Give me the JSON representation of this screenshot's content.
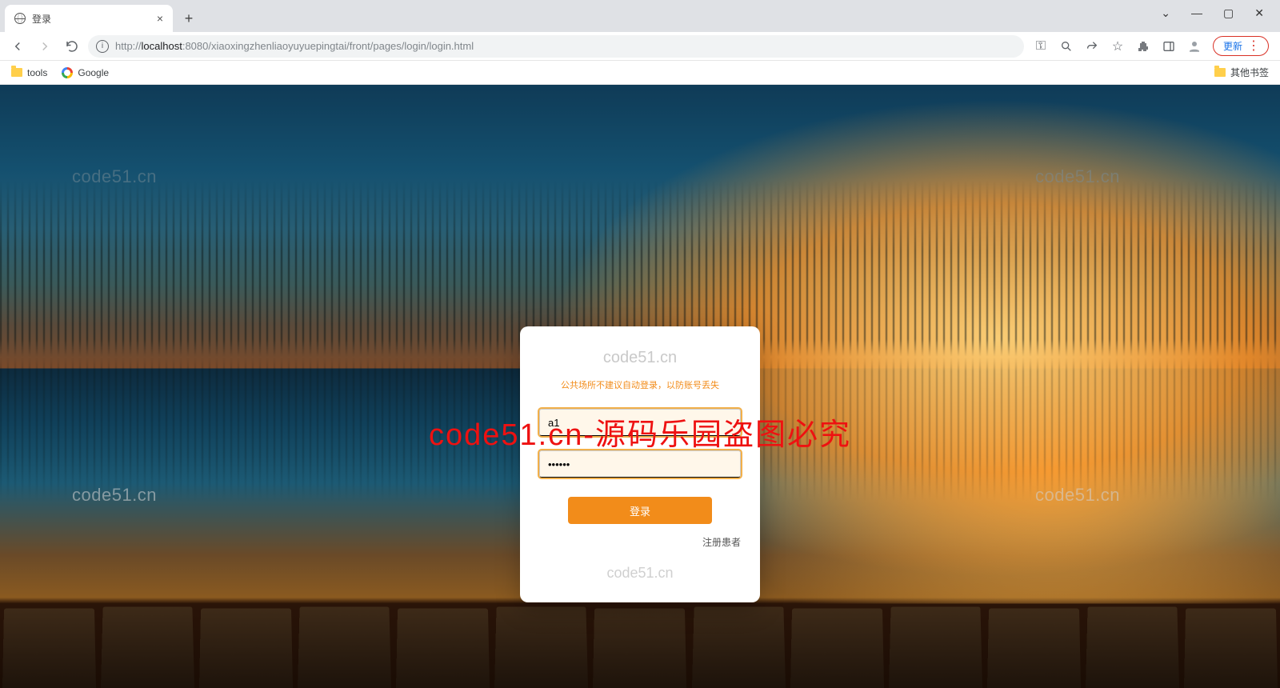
{
  "browser": {
    "tab_title": "登录",
    "new_tab": "+",
    "close_tab": "×",
    "url_prefix": "http://",
    "url_host": "localhost",
    "url_port": ":8080",
    "url_path": "/xiaoxingzhenliaoyuyuepingtai/front/pages/login/login.html",
    "update_label": "更新",
    "bookmarks": {
      "tools": "tools",
      "google": "Google",
      "other": "其他书签"
    }
  },
  "watermarks": {
    "text": "code51.cn",
    "big": "code51.cn-源码乐园盗图必究"
  },
  "login": {
    "hint": "公共场所不建议自动登录，以防账号丢失",
    "username_value": "a1",
    "password_value": "••••••",
    "button": "登录",
    "register": "注册患者"
  }
}
